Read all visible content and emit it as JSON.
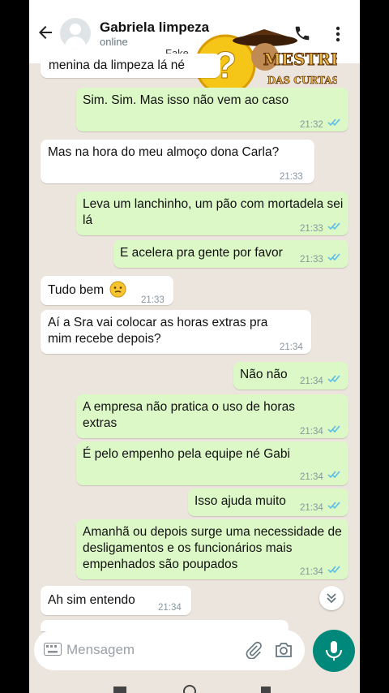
{
  "header": {
    "contact_name": "Gabriela limpeza",
    "status": "online",
    "overlay_text": "Fake"
  },
  "watermark": {
    "line1": "MESTRE",
    "line2": "DAS CURTAS"
  },
  "messages": [
    {
      "dir": "in",
      "text": "menina da limpeza lá né",
      "time": ""
    },
    {
      "dir": "out",
      "text": "Sim. Sim. Mas isso não vem ao caso",
      "time": "21:32"
    },
    {
      "dir": "in",
      "text": "Mas na hora do meu almoço dona Carla?",
      "time": "21:33"
    },
    {
      "dir": "out",
      "text": "Leva um lanchinho, um pão com mortadela sei lá",
      "time": "21:33"
    },
    {
      "dir": "out",
      "text": "E acelera pra gente por favor",
      "time": "21:33"
    },
    {
      "dir": "in",
      "text": "Tudo bem",
      "time": "21:33"
    },
    {
      "dir": "in",
      "text": "Aí a Sra vai colocar as horas extras pra mim recebe depois?",
      "time": "21:34"
    },
    {
      "dir": "out",
      "text": "Não não",
      "time": "21:34"
    },
    {
      "dir": "out",
      "text": "A empresa não pratica o uso de horas extras",
      "time": "21:34"
    },
    {
      "dir": "out",
      "text": "É pelo empenho pela equipe né Gabi",
      "time": "21:34"
    },
    {
      "dir": "out",
      "text": "Isso ajuda muito",
      "time": "21:34"
    },
    {
      "dir": "out",
      "text": "Amanhã ou depois surge uma necessidade de desligamentos e os funcionários mais empenhados são poupados",
      "time": "21:34"
    },
    {
      "dir": "in",
      "text": "Ah sim entendo",
      "time": "21:34"
    }
  ],
  "composer": {
    "placeholder": "Mensagem"
  },
  "colors": {
    "chat_bg": "#ece5dd",
    "outgoing": "#dcf8c6",
    "incoming": "#ffffff",
    "accent": "#00897b",
    "read_tick": "#53bdeb"
  },
  "icons": [
    "back-arrow-icon",
    "avatar-icon",
    "phone-icon",
    "more-vert-icon",
    "read-ticks-icon",
    "chevron-down-icon",
    "keyboard-icon",
    "attach-icon",
    "camera-icon",
    "mic-icon"
  ]
}
